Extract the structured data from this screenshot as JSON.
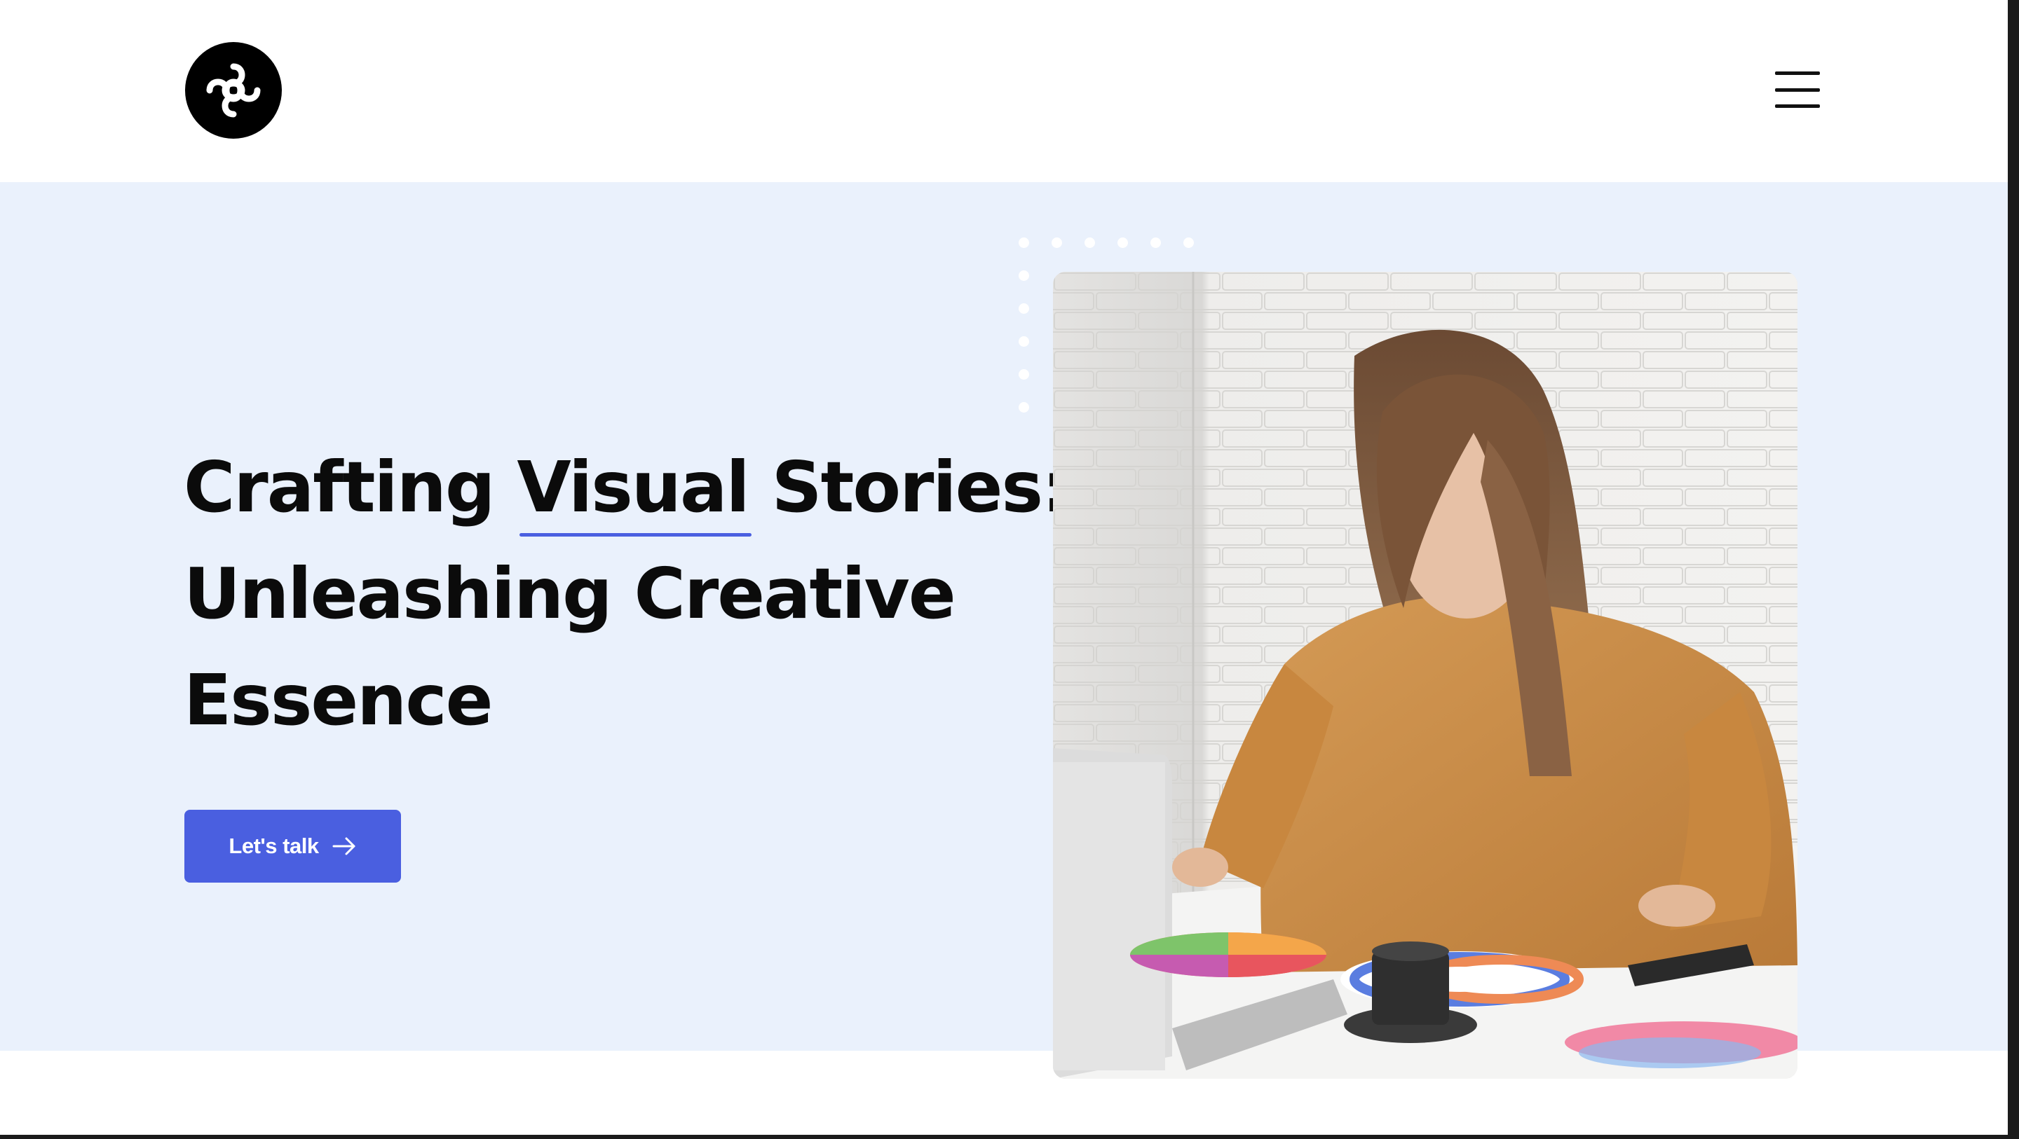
{
  "header": {
    "logo_icon": "knot-logo-icon",
    "menu_icon": "hamburger-menu-icon"
  },
  "hero": {
    "title_line1_before": "Crafting ",
    "title_line1_highlight": "Visual",
    "title_line1_after": " Stories:",
    "title_line2": "Unleashing Creative",
    "title_line3": "Essence",
    "cta_label": "Let's talk",
    "cta_icon": "arrow-right-icon",
    "image_subject": "woman-working-with-color-wheels-photo"
  },
  "colors": {
    "hero_background": "#eaf1fc",
    "accent": "#4a5fe0",
    "text": "#0b0b0b"
  }
}
